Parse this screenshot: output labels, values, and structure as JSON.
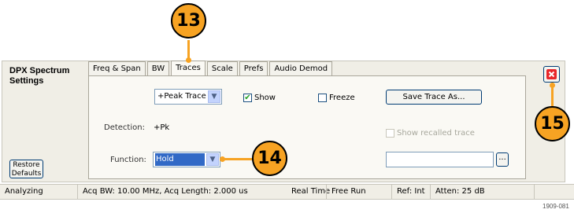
{
  "sidebar": {
    "title": "DPX Spectrum\nSettings",
    "restore_label": "Restore\nDefaults"
  },
  "tabs": [
    {
      "label": "Freq & Span",
      "active": false
    },
    {
      "label": "BW",
      "active": false
    },
    {
      "label": "Traces",
      "active": true
    },
    {
      "label": "Scale",
      "active": false
    },
    {
      "label": "Prefs",
      "active": false
    },
    {
      "label": "Audio Demod",
      "active": false
    }
  ],
  "traces": {
    "trace_select": "+Peak Trace",
    "show_label": "Show",
    "show_checked": true,
    "freeze_label": "Freeze",
    "freeze_checked": false,
    "save_button": "Save Trace As...",
    "detection_label": "Detection:",
    "detection_value": "+Pk",
    "show_recalled_label": "Show recalled trace",
    "show_recalled_checked": false,
    "function_label": "Function:",
    "function_value": "Hold",
    "file_path_value": "",
    "browse_label": "..."
  },
  "close_button": {
    "icon": "close-x-icon",
    "color": "#e8262a"
  },
  "status_bar": {
    "state": "Analyzing",
    "acq": "Acq BW: 10.00 MHz, Acq Length: 2.000 us",
    "realtime": "Real Time",
    "run": "Free Run",
    "ref": "Ref: Int",
    "atten": "Atten: 25 dB"
  },
  "callouts": [
    "13",
    "14",
    "15"
  ],
  "figure_id": "1909-081",
  "colors": {
    "callout": "#f7a323",
    "panel": "#faf9f4",
    "dialog": "#f0eee6",
    "selection": "#3169c6"
  }
}
